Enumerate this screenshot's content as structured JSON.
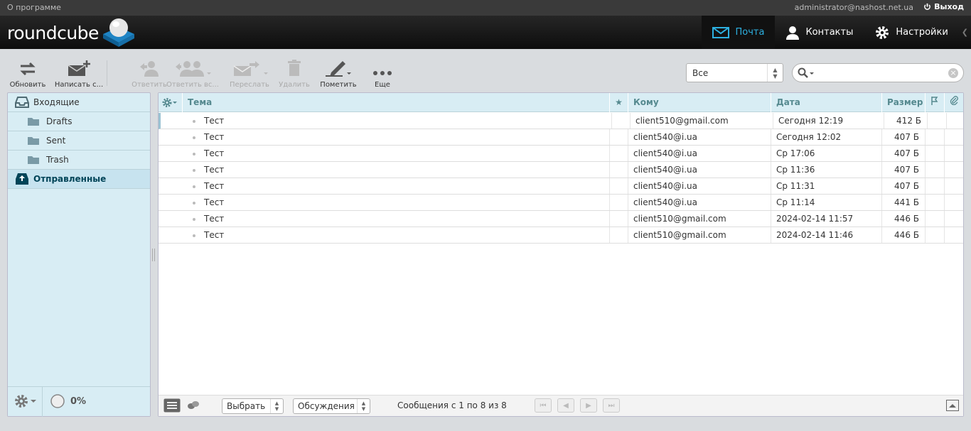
{
  "topbar": {
    "about": "О программе",
    "user_email": "administrator@nashost.net.ua",
    "logout": "Выход"
  },
  "app": {
    "logo": "roundcube"
  },
  "nav": {
    "mail": "Почта",
    "contacts": "Контакты",
    "settings": "Настройки"
  },
  "toolbar": {
    "refresh": "Обновить",
    "compose": "Написать с...",
    "reply": "Ответить",
    "reply_all": "Ответить вс...",
    "forward": "Переслать",
    "delete": "Удалить",
    "mark": "Пометить",
    "more": "Еще"
  },
  "filter": {
    "selected": "Все"
  },
  "search": {
    "placeholder": ""
  },
  "folders": [
    {
      "label": "Входящие",
      "level": "top"
    },
    {
      "label": "Drafts",
      "level": "sub"
    },
    {
      "label": "Sent",
      "level": "sub"
    },
    {
      "label": "Trash",
      "level": "sub"
    },
    {
      "label": "Отправленные",
      "level": "top",
      "selected": true
    }
  ],
  "quota": {
    "value": "0%"
  },
  "list": {
    "columns": {
      "subject": "Тема",
      "to": "Кому",
      "date": "Дата",
      "size": "Размер"
    },
    "rows": [
      {
        "subject": "Тест",
        "to": "client510@gmail.com",
        "date": "Сегодня 12:19",
        "size": "412 Б"
      },
      {
        "subject": "Тест",
        "to": "client540@i.ua",
        "date": "Сегодня 12:02",
        "size": "407 Б"
      },
      {
        "subject": "Тест",
        "to": "client540@i.ua",
        "date": "Ср 17:06",
        "size": "407 Б"
      },
      {
        "subject": "Тест",
        "to": "client540@i.ua",
        "date": "Ср 11:36",
        "size": "407 Б"
      },
      {
        "subject": "Тест",
        "to": "client540@i.ua",
        "date": "Ср 11:31",
        "size": "407 Б"
      },
      {
        "subject": "Тест",
        "to": "client540@i.ua",
        "date": "Ср 11:14",
        "size": "441 Б"
      },
      {
        "subject": "Тест",
        "to": "client510@gmail.com",
        "date": "2024-02-14 11:57",
        "size": "446 Б"
      },
      {
        "subject": "Тест",
        "to": "client510@gmail.com",
        "date": "2024-02-14 11:46",
        "size": "446 Б"
      }
    ]
  },
  "footer": {
    "select": "Выбрать",
    "threads": "Обсуждения",
    "count": "Сообщения с 1 по 8 из 8"
  },
  "colors": {
    "accent": "#2db0e0",
    "panel": "#d8edf4",
    "header_text": "#55898f"
  }
}
